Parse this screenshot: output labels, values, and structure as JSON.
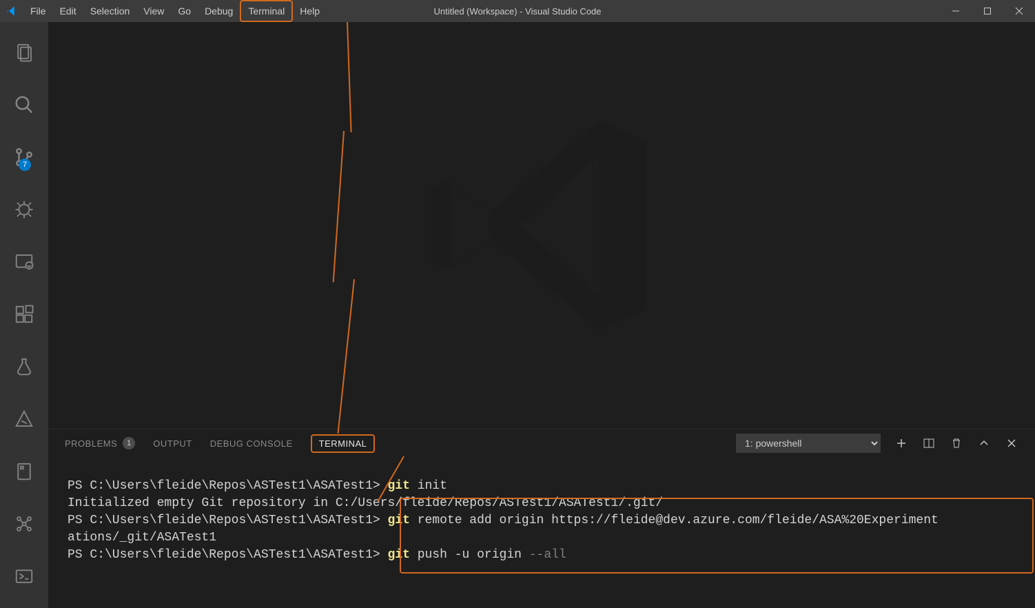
{
  "title": "Untitled (Workspace) - Visual Studio Code",
  "menu": {
    "file": "File",
    "edit": "Edit",
    "selection": "Selection",
    "view": "View",
    "go": "Go",
    "debug": "Debug",
    "terminal": "Terminal",
    "help": "Help"
  },
  "activity": {
    "scm_badge": "7"
  },
  "panel": {
    "tabs": {
      "problems": "PROBLEMS",
      "problems_count": "1",
      "output": "OUTPUT",
      "debug_console": "DEBUG CONSOLE",
      "terminal": "TERMINAL"
    },
    "terminal_selector": "1: powershell"
  },
  "terminal": {
    "line1_prompt": "PS C:\\Users\\fleide\\Repos\\ASTest1\\ASATest1> ",
    "line1_cmd_hl": "git",
    "line1_cmd_rest": " init",
    "line2": "Initialized empty Git repository in C:/Users/fleide/Repos/ASTest1/ASATest1/.git/",
    "line3_prompt": "PS C:\\Users\\fleide\\Repos\\ASTest1\\ASATest1> ",
    "line3_cmd_hl": "git",
    "line3_cmd_rest": " remote add origin https://fleide@dev.azure.com/fleide/ASA%20Experiment",
    "line4": "ations/_git/ASATest1",
    "line5_prompt": "PS C:\\Users\\fleide\\Repos\\ASTest1\\ASATest1> ",
    "line5_cmd_hl": "git",
    "line5_cmd_rest": " push -u origin ",
    "line5_gray": "--all"
  }
}
